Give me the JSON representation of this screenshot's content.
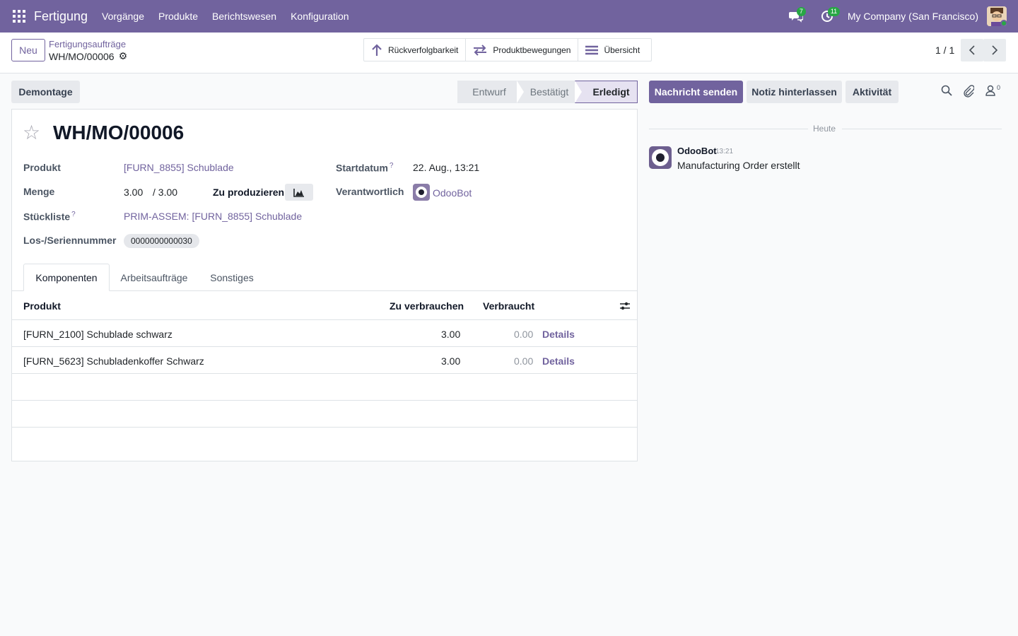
{
  "navbar": {
    "app_name": "Fertigung",
    "menu": [
      "Vorgänge",
      "Produkte",
      "Berichtswesen",
      "Konfiguration"
    ],
    "messages_count": "7",
    "activities_count": "11",
    "company": "My Company (San Francisco)"
  },
  "control": {
    "new_label": "Neu",
    "breadcrumb_parent": "Fertigungsaufträge",
    "breadcrumb_current": "WH/MO/00006",
    "smart_buttons": [
      "Rückverfolgbarkeit",
      "Produktbewegungen",
      "Übersicht"
    ],
    "pager": "1 / 1"
  },
  "statusbar": {
    "demontage_label": "Demontage",
    "steps": [
      "Entwurf",
      "Bestätigt",
      "Erledigt"
    ],
    "active_step": "Erledigt"
  },
  "form": {
    "title": "WH/MO/00006",
    "fields": {
      "product_label": "Produkt",
      "product_value": "[FURN_8855] Schublade",
      "quantity_label": "Menge",
      "quantity_value": "3.00",
      "quantity_total": "/ 3.00",
      "to_produce_label": "Zu produzieren",
      "bom_label": "Stückliste",
      "bom_value": "PRIM-ASSEM: [FURN_8855] Schublade",
      "lot_label": "Los-/Seriennummer",
      "lot_value": "0000000000030",
      "start_label": "Startdatum",
      "start_value": "22. Aug., 13:21",
      "responsible_label": "Verantwortlich",
      "responsible_value": "OdooBot",
      "help_mark": "?"
    },
    "tabs": [
      "Komponenten",
      "Arbeitsaufträge",
      "Sonstiges"
    ],
    "table": {
      "columns": [
        "Produkt",
        "Zu verbrauchen",
        "Verbraucht"
      ],
      "rows": [
        {
          "product": "[FURN_2100] Schublade schwarz",
          "to_consume": "3.00",
          "consumed": "0.00",
          "action": "Details"
        },
        {
          "product": "[FURN_5623] Schubladenkoffer Schwarz",
          "to_consume": "3.00",
          "consumed": "0.00",
          "action": "Details"
        }
      ]
    }
  },
  "chatter": {
    "send_message": "Nachricht senden",
    "log_note": "Notiz hinterlassen",
    "activity": "Aktivität",
    "followers_count": "0",
    "date_separator": "Heute",
    "message": {
      "author": "OdooBot",
      "time": "13:21",
      "body": "Manufacturing Order erstellt"
    }
  },
  "colors": {
    "brand": "#71639e",
    "badge": "#28a745",
    "link": "#71639e"
  },
  "icons": [
    "apps-grid-icon",
    "chat-bubbles-icon",
    "clock-icon",
    "arrow-up-icon",
    "arrows-exchange-icon",
    "bars-icon",
    "gear-icon",
    "star-icon",
    "area-chart-icon",
    "sliders-icon",
    "search-icon",
    "paperclip-icon",
    "person-icon",
    "chevron-left-icon",
    "chevron-right-icon"
  ]
}
